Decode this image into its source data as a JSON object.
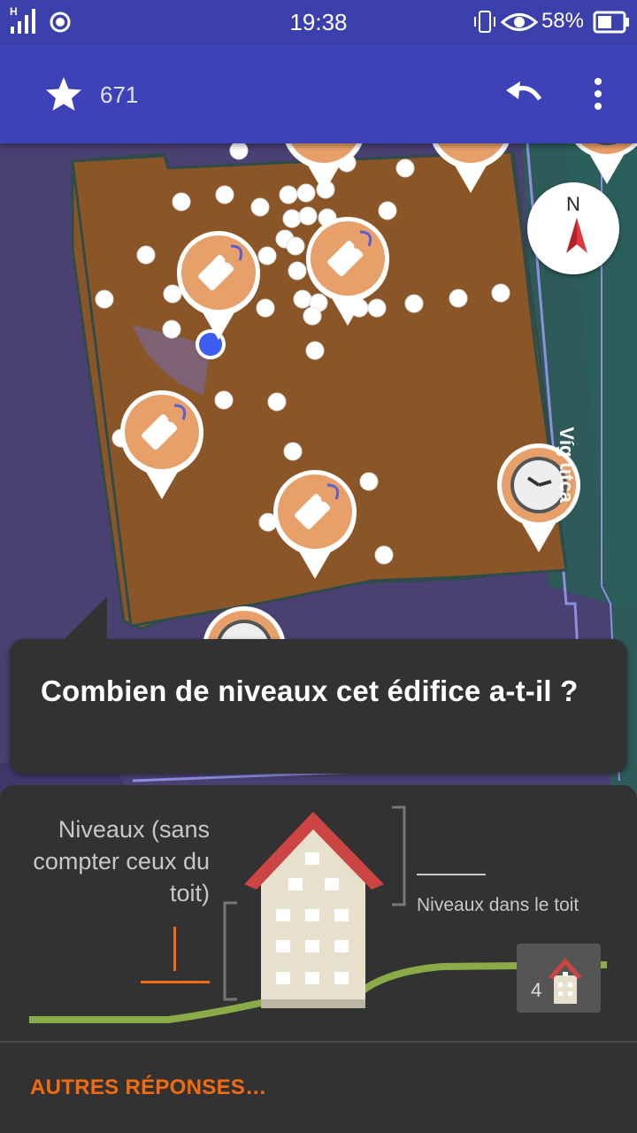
{
  "status_bar": {
    "time": "19:38",
    "battery": "58%",
    "network_label": "H",
    "icons": [
      "signal-icon",
      "location-target-icon",
      "vibrate-icon",
      "eye-icon",
      "battery-icon"
    ]
  },
  "app_bar": {
    "star_count": "671",
    "icons": [
      "star-icon",
      "undo-icon",
      "overflow-menu-icon"
    ]
  },
  "map": {
    "street_name": "Víg utca",
    "compass_label": "N",
    "markers": [
      "price-tag-icon",
      "clock-icon"
    ]
  },
  "question": {
    "text": "Combien de niveaux cet édifice a-t-il ?"
  },
  "answer": {
    "levels_label": "Niveaux (sans compter ceux du toit)",
    "roof_levels_label": "Niveaux dans le toit",
    "levels_value": "",
    "roof_levels_value": "",
    "building_badge_number": "4",
    "other_answers_button": "AUTRES RÉPONSES…"
  },
  "colors": {
    "app_bar": "#3d42b8",
    "building_fill": "#8b5627",
    "marker": "#e8a06a",
    "card": "#323232",
    "accent": "#f26b0f",
    "ground_line": "#8bab48",
    "roof": "#cc4444"
  }
}
